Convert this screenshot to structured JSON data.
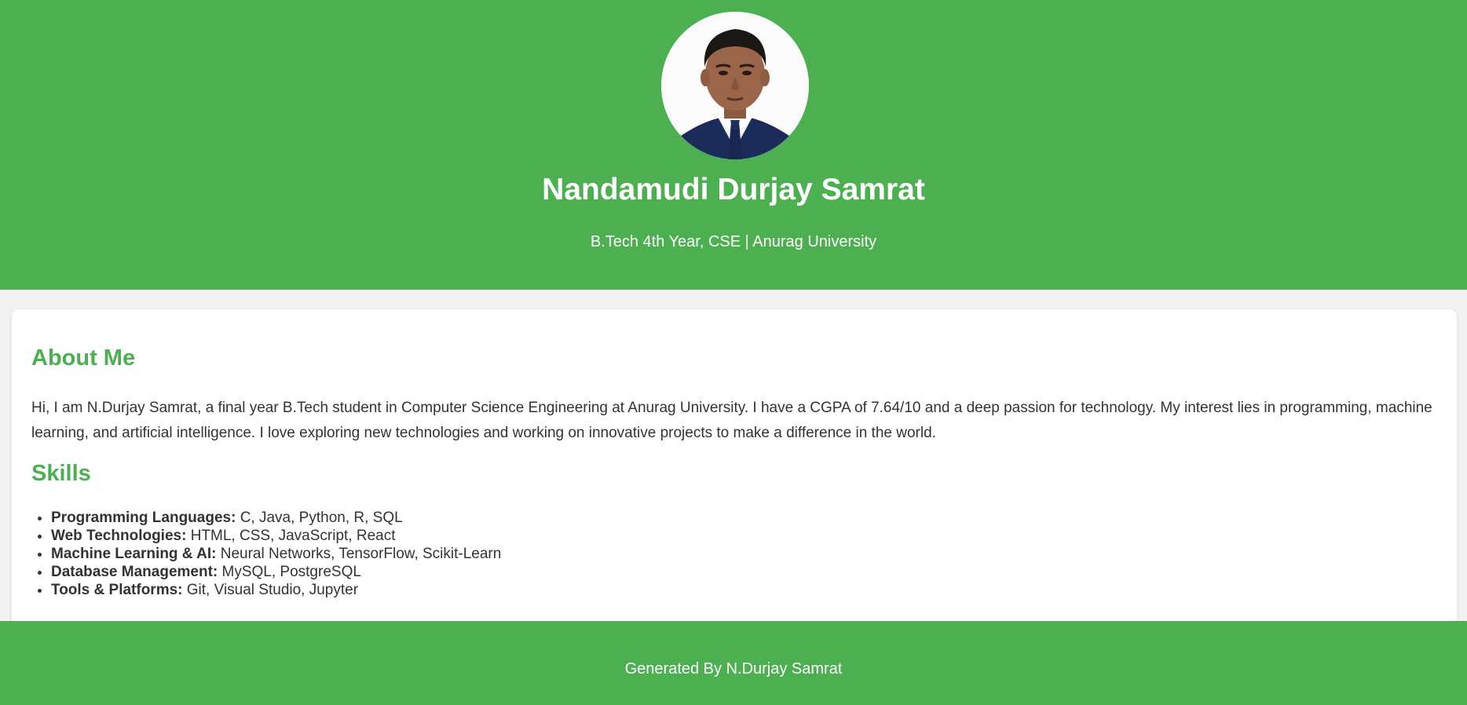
{
  "header": {
    "name": "Nandamudi Durjay Samrat",
    "subtitle": "B.Tech 4th Year, CSE | Anurag University",
    "avatar_alt": "Profile photo"
  },
  "about": {
    "title": "About Me",
    "text": "Hi, I am N.Durjay Samrat, a final year B.Tech student in Computer Science Engineering at Anurag University. I have a CGPA of 7.64/10 and a deep passion for technology. My interest lies in programming, machine learning, and artificial intelligence. I love exploring new technologies and working on innovative projects to make a difference in the world."
  },
  "skills": {
    "title": "Skills",
    "items": [
      {
        "label": "Programming Languages:",
        "value": " C, Java, Python, R, SQL"
      },
      {
        "label": "Web Technologies:",
        "value": " HTML, CSS, JavaScript, React"
      },
      {
        "label": "Machine Learning & AI:",
        "value": " Neural Networks, TensorFlow, Scikit-Learn"
      },
      {
        "label": "Database Management:",
        "value": " MySQL, PostgreSQL"
      },
      {
        "label": "Tools & Platforms:",
        "value": " Git, Visual Studio, Jupyter"
      }
    ]
  },
  "footer": {
    "text": "Generated By N.Durjay Samrat"
  },
  "colors": {
    "accent": "#4caf50",
    "page_background": "#f2f2f2",
    "card_background": "#ffffff",
    "text": "#333333"
  }
}
